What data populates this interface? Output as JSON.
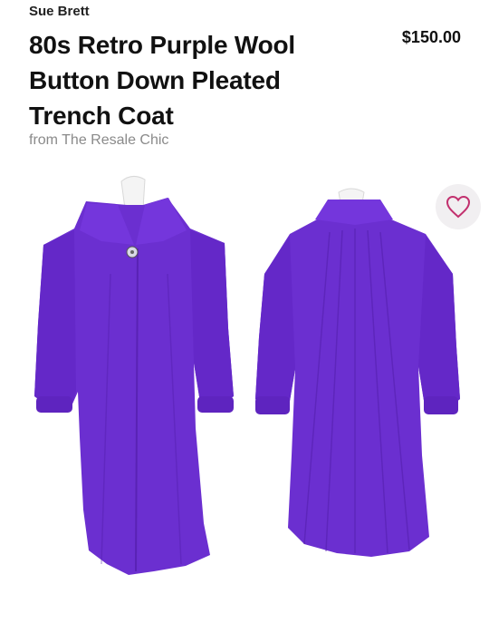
{
  "product": {
    "brand": "Sue Brett",
    "title": "80s Retro Purple Wool Button Down Pleated Trench Coat",
    "price": "$150.00",
    "seller": "from The Resale Chic"
  },
  "icons": {
    "favorite": "heart-outline-icon"
  },
  "colors": {
    "coat": "#6b2fd0",
    "heart": "#c2306e"
  }
}
